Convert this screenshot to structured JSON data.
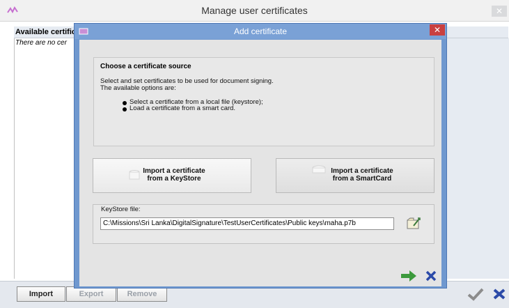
{
  "outer_window": {
    "title": "Manage user certificates",
    "close_icon": "close-icon",
    "panel_header": "Available certific",
    "empty_text": "There are no cer",
    "buttons": {
      "import": "Import",
      "export": "Export",
      "remove": "Remove"
    }
  },
  "dialog": {
    "title": "Add certificate",
    "close_icon": "close-icon",
    "source": {
      "heading": "Choose a certificate source",
      "description_line1": "Select and set certificates to be used for document signing.",
      "description_line2": "The available options are:",
      "options": [
        "Select a certificate from a local file (keystore);",
        "Load a certificate from a smart card."
      ]
    },
    "import_keystore": {
      "line1": "Import a certificate",
      "line2": "from a KeyStore",
      "icon": "keystore-icon"
    },
    "import_smartcard": {
      "line1": "Import a certificate",
      "line2": "from a SmartCard",
      "icon": "smartcard-icon"
    },
    "keystore": {
      "label": "KeyStore file:",
      "value": "C:\\Missions\\Sri Lanka\\DigitalSignature\\TestUserCertificates\\Public keys\\maha.p7b",
      "browse_icon": "folder-browse-icon"
    },
    "next_icon": "arrow-right-icon",
    "cancel_icon": "cancel-x-icon"
  },
  "colors": {
    "dialog_frame": "#6f98cf",
    "dialog_close": "#c94040",
    "next_arrow": "#3c9a3c",
    "cancel_x": "#2b4aa8",
    "ok_check": "#8c8c8c"
  }
}
